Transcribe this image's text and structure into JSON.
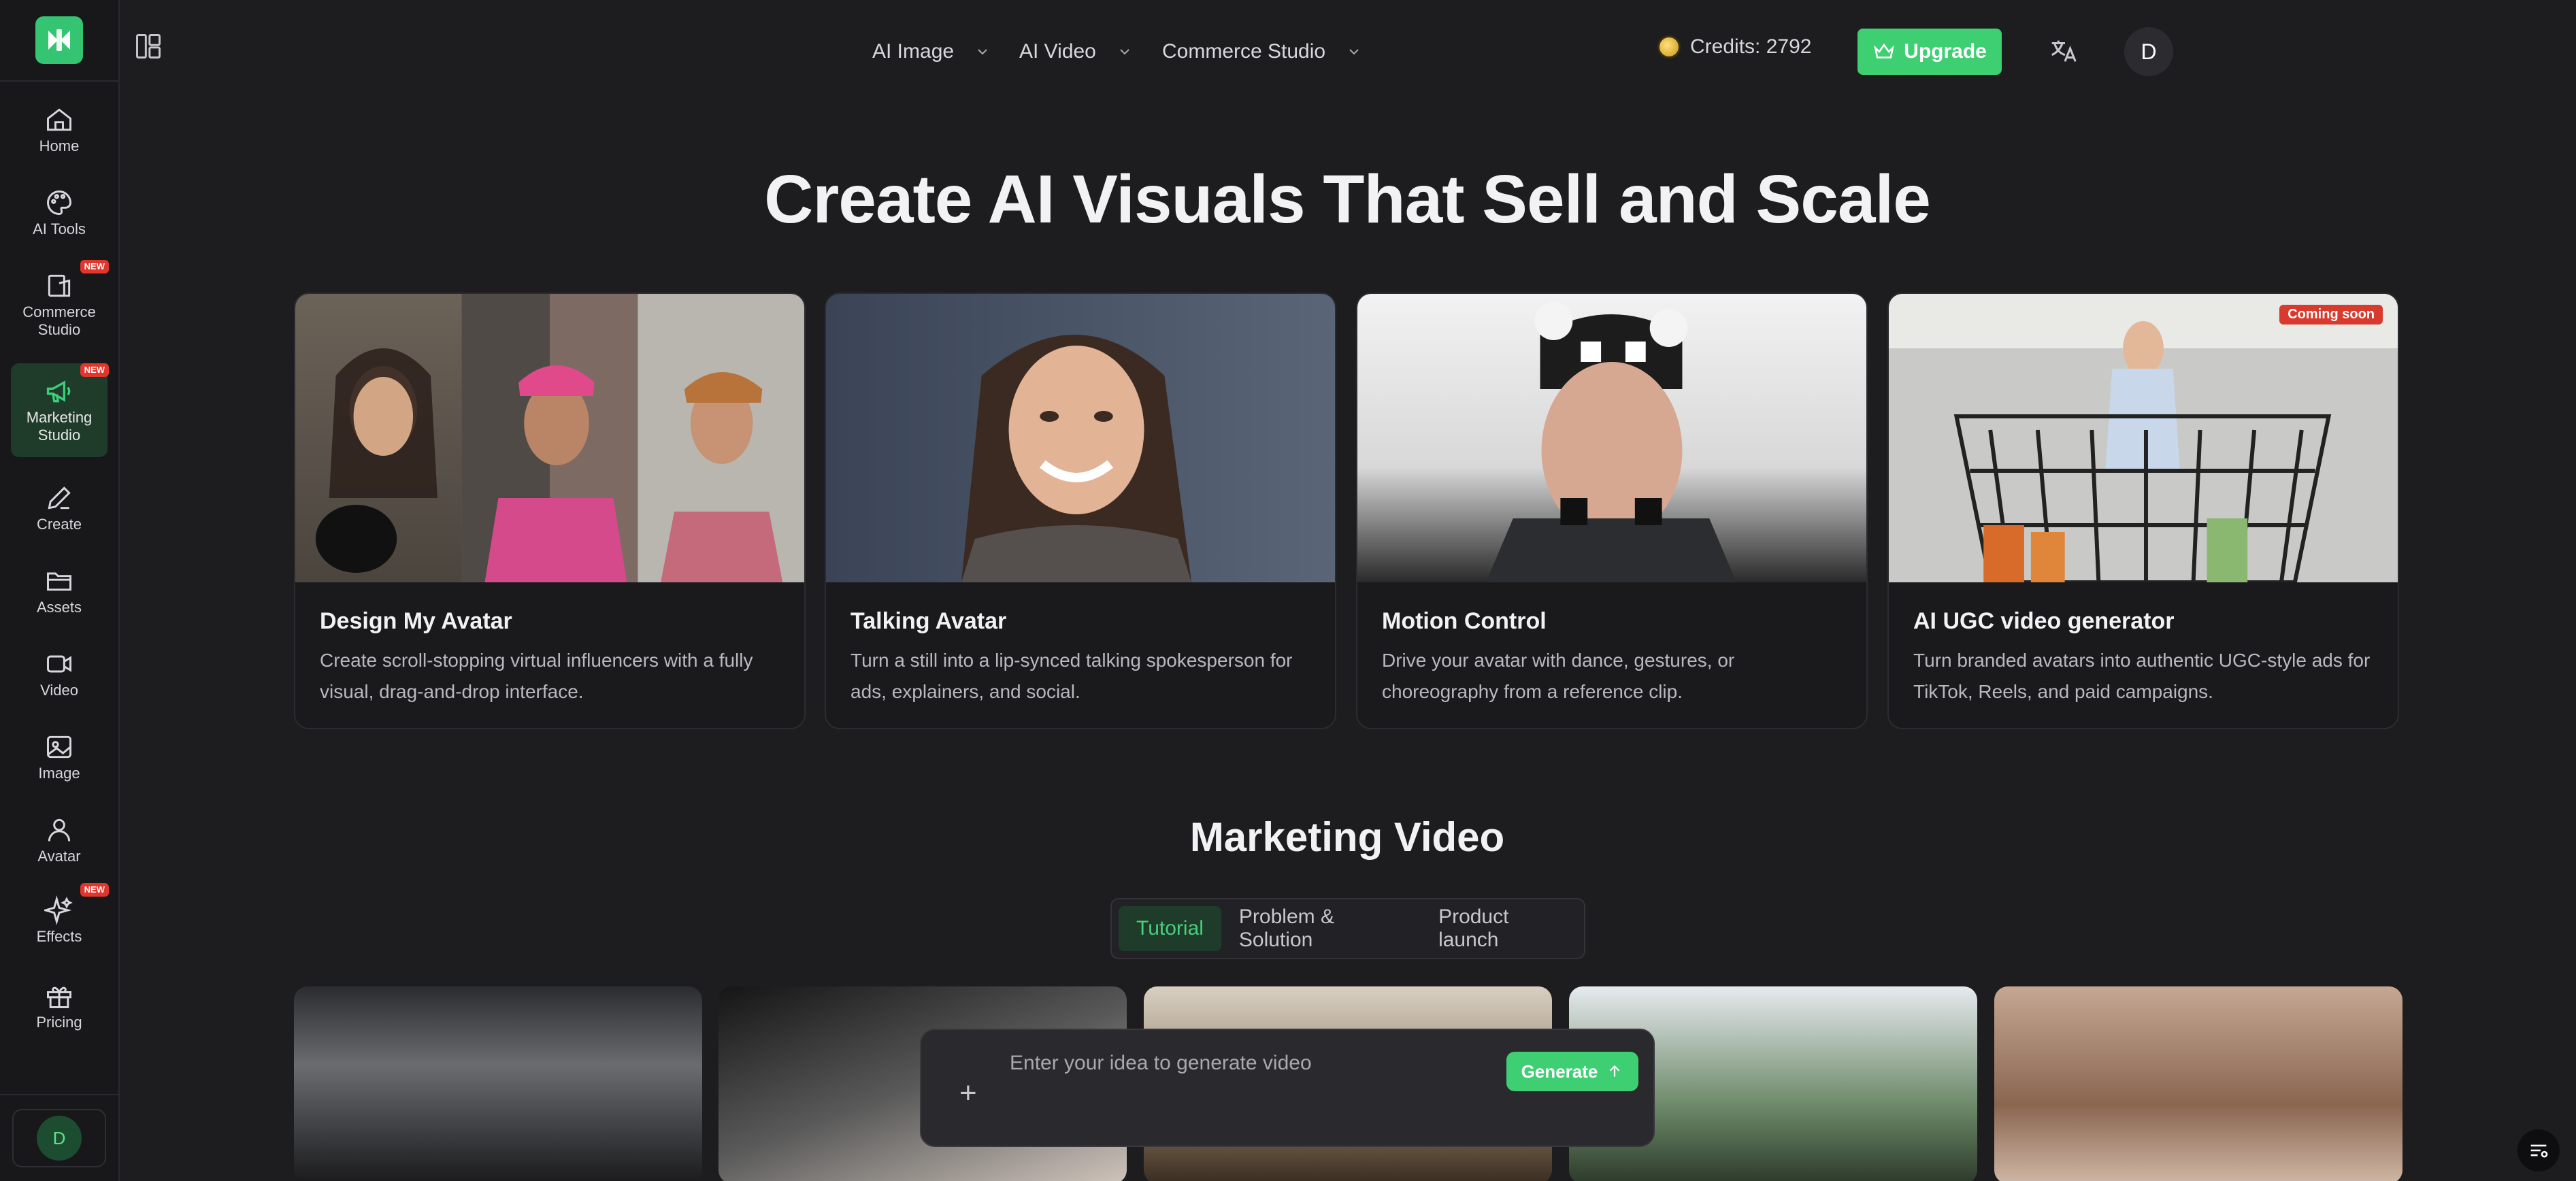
{
  "colors": {
    "accent": "#3fcf73",
    "background": "#1d1d20",
    "badge": "#e0362c"
  },
  "sidebar": {
    "items": [
      {
        "label": "Home",
        "icon": "home-icon",
        "new": false
      },
      {
        "label": "AI Tools",
        "icon": "palette-icon",
        "new": false
      },
      {
        "label": "Commerce Studio",
        "icon": "commerce-icon",
        "new": true
      },
      {
        "label": "Marketing Studio",
        "icon": "megaphone-icon",
        "new": true,
        "active": true
      },
      {
        "label": "Create",
        "icon": "pen-icon",
        "new": false
      },
      {
        "label": "Assets",
        "icon": "folder-icon",
        "new": false
      },
      {
        "label": "Video",
        "icon": "video-icon",
        "new": false
      },
      {
        "label": "Image",
        "icon": "image-icon",
        "new": false
      },
      {
        "label": "Avatar",
        "icon": "user-icon",
        "new": false
      },
      {
        "label": "Effects",
        "icon": "sparkle-icon",
        "new": true
      },
      {
        "label": "Pricing",
        "icon": "gift-icon",
        "new": false
      }
    ],
    "new_badge": "NEW",
    "user_initial": "D"
  },
  "topbar": {
    "menus": [
      "AI Image",
      "AI Video",
      "Commerce Studio"
    ],
    "credits": "Credits: 2792",
    "upgrade": "Upgrade",
    "avatar_initial": "D"
  },
  "hero": {
    "title": "Create AI Visuals That Sell and Scale"
  },
  "features": [
    {
      "title": "Design My Avatar",
      "desc": "Create scroll-stopping virtual influencers with a fully visual, drag-and-drop interface."
    },
    {
      "title": "Talking Avatar",
      "desc": "Turn a still into a lip-synced talking spokesperson for ads, explainers, and social."
    },
    {
      "title": "Motion Control",
      "desc": "Drive your avatar with dance, gestures, or choreography from a reference clip."
    },
    {
      "title": "AI UGC video generator",
      "desc": "Turn branded avatars into authentic UGC-style ads for TikTok, Reels, and paid campaigns.",
      "badge": "Coming soon"
    }
  ],
  "marketing": {
    "title": "Marketing Video",
    "tabs": [
      "Tutorial",
      "Problem & Solution",
      "Product launch"
    ],
    "active_tab": "Tutorial"
  },
  "prompt": {
    "placeholder": "Enter your idea to generate video",
    "generate": "Generate"
  }
}
